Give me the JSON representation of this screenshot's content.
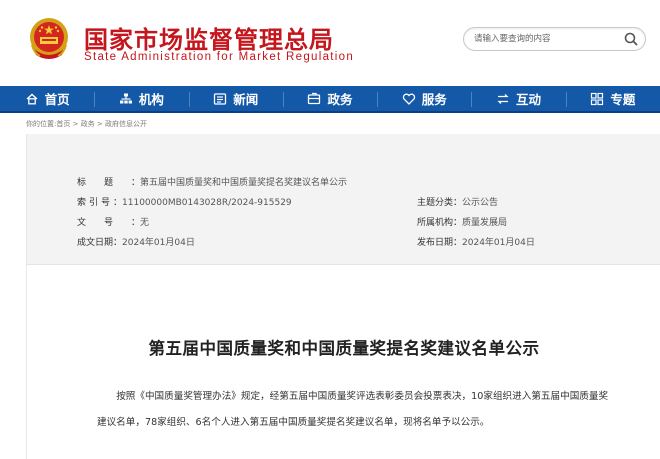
{
  "header": {
    "title": "国家市场监督管理总局",
    "subtitle": "State Administration for Market Regulation",
    "search_placeholder": "请输入要查询的内容"
  },
  "nav": {
    "items": [
      {
        "label": "首页",
        "icon": "home-icon"
      },
      {
        "label": "机构",
        "icon": "org-icon"
      },
      {
        "label": "新闻",
        "icon": "news-icon"
      },
      {
        "label": "政务",
        "icon": "affairs-icon"
      },
      {
        "label": "服务",
        "icon": "service-icon"
      },
      {
        "label": "互动",
        "icon": "interact-icon"
      },
      {
        "label": "专题",
        "icon": "topic-icon"
      }
    ]
  },
  "breadcrumb": {
    "prefix": "你的位置:",
    "items": [
      "首页",
      "政务",
      "政府信息公开"
    ],
    "separator": " > "
  },
  "meta": {
    "title_label": "标题",
    "title_value": "第五届中国质量奖和中国质量奖提名奖建议名单公示",
    "index_label": "索引号",
    "index_value": "11100000MB0143028R/2024-915529",
    "docno_label": "文号",
    "docno_value": "无",
    "created_label": "成文日期",
    "created_value": "2024年01月04日",
    "category_label": "主题分类",
    "category_value": "公示公告",
    "org_label": "所属机构",
    "org_value": "质量发展局",
    "published_label": "发布日期",
    "published_value": "2024年01月04日"
  },
  "article": {
    "title": "第五届中国质量奖和中国质量奖提名奖建议名单公示",
    "body": "按照《中国质量奖管理办法》规定，经第五届中国质量奖评选表彰委员会投票表决，10家组织进入第五届中国质量奖建议名单，78家组织、6名个人进入第五届中国质量奖提名奖建议名单，现将名单予以公示。"
  },
  "colors": {
    "brand_red": "#c4161c",
    "nav_blue": "#1458a8",
    "meta_bg": "#f3f3f3"
  }
}
